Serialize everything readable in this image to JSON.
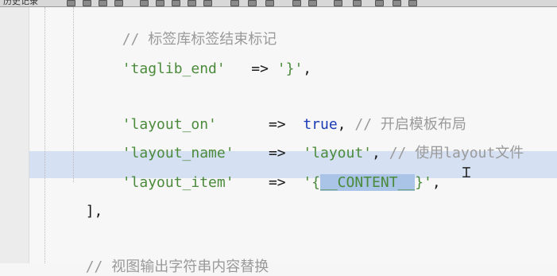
{
  "toolbar": {
    "label": "历史记录"
  },
  "code": {
    "line_taglib_comment": "// 标签库标签结束标记",
    "taglib_end_key": "'taglib_end'",
    "taglib_end_arrow": "=>",
    "taglib_end_value": "'}'",
    "taglib_end_comma": ",",
    "layout_on_key": "'layout_on'",
    "layout_on_arrow": "=>",
    "layout_on_value": "true",
    "layout_on_comma": ",",
    "layout_on_comment": "// 开启模板布局",
    "layout_name_key": "'layout_name'",
    "layout_name_arrow": "=>",
    "layout_name_value": "'layout'",
    "layout_name_comma": ",",
    "layout_name_comment": "// 使用layout文件",
    "layout_item_key": "'layout_item'",
    "layout_item_arrow": "=>",
    "layout_item_open": "'{",
    "layout_item_selected": "__CONTENT__",
    "layout_item_close": "}'",
    "layout_item_comma": ",",
    "array_close": "],",
    "view_comment": "// 视图输出字符串内容替换"
  },
  "editor": {
    "mouse_cursor": "I-beam"
  }
}
